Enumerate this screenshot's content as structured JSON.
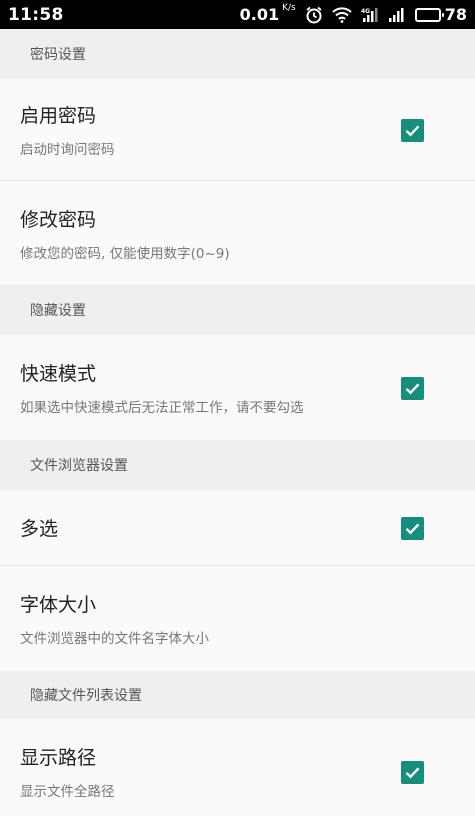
{
  "status_bar": {
    "time": "11:58",
    "net_speed": "0.01",
    "net_unit": "K/s",
    "battery": "78"
  },
  "sections": [
    {
      "header": "密码设置",
      "items": [
        {
          "title": "启用密码",
          "summary": "启动时询问密码",
          "checked": true
        },
        {
          "title": "修改密码",
          "summary": "修改您的密码, 仅能使用数字(0~9)"
        }
      ]
    },
    {
      "header": "隐藏设置",
      "items": [
        {
          "title": "快速模式",
          "summary": "如果选中快速模式后无法正常工作，请不要勾选",
          "checked": true
        }
      ]
    },
    {
      "header": "文件浏览器设置",
      "items": [
        {
          "title": "多选",
          "checked": true
        },
        {
          "title": "字体大小",
          "summary": "文件浏览器中的文件名字体大小"
        }
      ]
    },
    {
      "header": "隐藏文件列表设置",
      "items": [
        {
          "title": "显示路径",
          "summary": "显示文件全路径",
          "checked": true
        }
      ]
    }
  ],
  "colors": {
    "accent": "#168d7d",
    "header_bg": "#efefef",
    "background": "#fafafa"
  }
}
